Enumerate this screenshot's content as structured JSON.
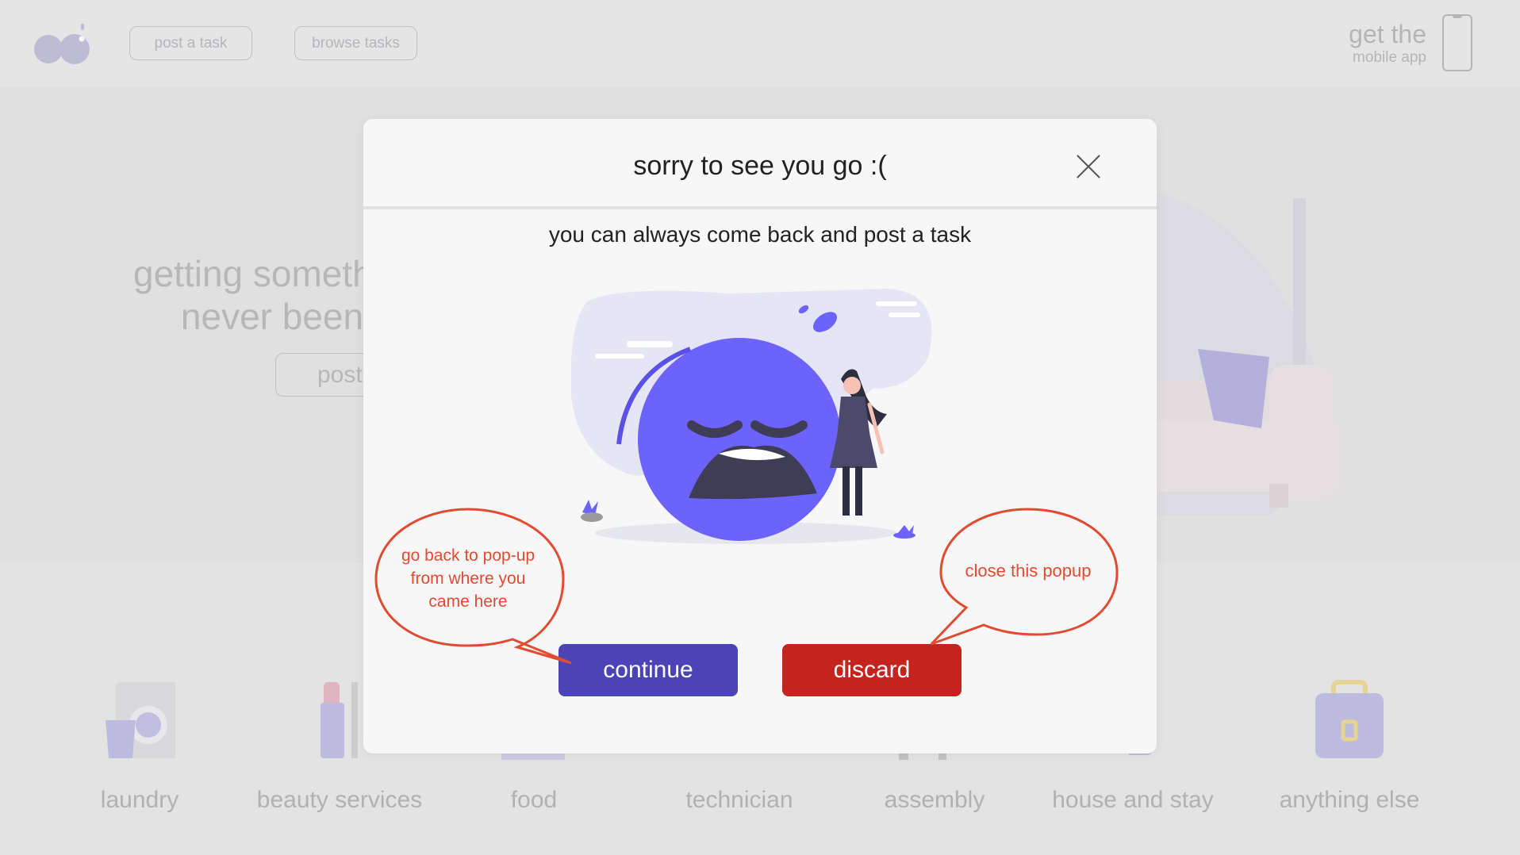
{
  "topbar": {
    "nav": [
      "post a task",
      "browse tasks"
    ],
    "app_line1": "get the",
    "app_line2": "mobile app"
  },
  "hero": {
    "line1": "getting someth",
    "line2": "never been",
    "button_label": "post"
  },
  "categories": [
    "laundry",
    "beauty services",
    "food",
    "technician",
    "assembly",
    "house and stay",
    "anything else"
  ],
  "modal": {
    "title": "sorry to see you go :(",
    "subtitle": "you can always come back and post a task",
    "continue_label": "continue",
    "discard_label": "discard"
  },
  "annotations": {
    "left_line1": "go back to pop-up",
    "left_line2": "from where you",
    "left_line3": "came here",
    "right": "close this popup"
  },
  "colors": {
    "accent": "#4b44b7",
    "danger": "#c4231e",
    "emoji": "#6c63ff",
    "annotation": "#e04b32"
  }
}
